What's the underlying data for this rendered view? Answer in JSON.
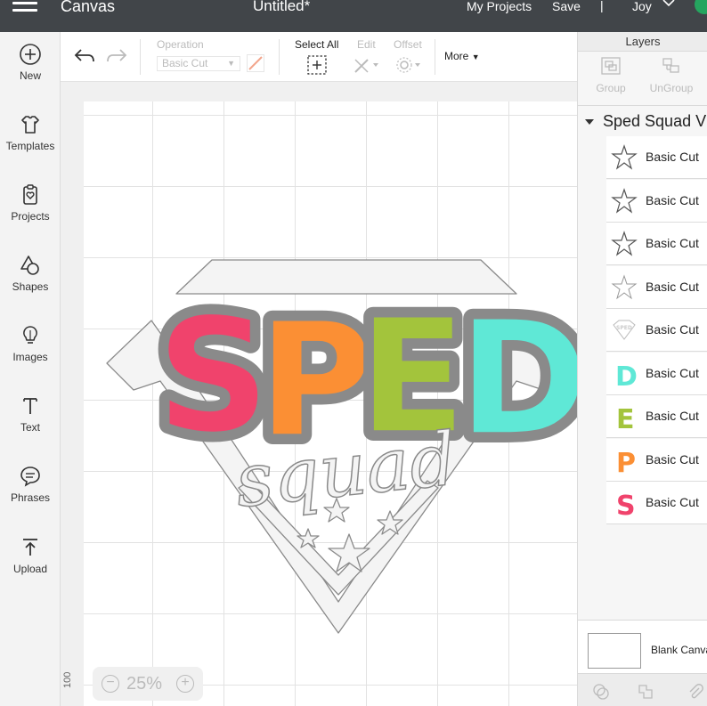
{
  "topbar": {
    "app_title": "Canvas",
    "doc_title": "Untitled*",
    "my_projects": "My Projects",
    "save": "Save",
    "separator": "|",
    "user": "Joy"
  },
  "nav": [
    {
      "label": "New",
      "icon": "plus-circle-icon"
    },
    {
      "label": "Templates",
      "icon": "tshirt-icon"
    },
    {
      "label": "Projects",
      "icon": "clipboard-heart-icon"
    },
    {
      "label": "Shapes",
      "icon": "shapes-icon"
    },
    {
      "label": "Images",
      "icon": "lightbulb-icon"
    },
    {
      "label": "Text",
      "icon": "text-icon"
    },
    {
      "label": "Phrases",
      "icon": "speech-bubble-icon"
    },
    {
      "label": "Upload",
      "icon": "upload-icon"
    }
  ],
  "toolbar": {
    "operation_label": "Operation",
    "operation_value": "Basic Cut",
    "select_all": "Select All",
    "edit": "Edit",
    "offset": "Offset",
    "more": "More"
  },
  "canvas": {
    "ruler_number": "100",
    "zoom": "25%",
    "design_text": {
      "sped": [
        "S",
        "P",
        "E",
        "D"
      ],
      "squad": "squad"
    },
    "colors": {
      "s": "#f0436c",
      "p": "#fb8f34",
      "e": "#a3c43c",
      "d": "#5fe8d6",
      "outline": "#f4f4f4",
      "stroke": "#8a8a8a"
    }
  },
  "layers": {
    "title": "Layers",
    "group_label": "Group",
    "ungroup_label": "UnGroup",
    "group_name": "Sped Squad V",
    "items": [
      {
        "name": "Basic Cut",
        "thumb": "star"
      },
      {
        "name": "Basic Cut",
        "thumb": "star"
      },
      {
        "name": "Basic Cut",
        "thumb": "star"
      },
      {
        "name": "Basic Cut",
        "thumb": "star"
      },
      {
        "name": "Basic Cut",
        "thumb": "diamond"
      },
      {
        "name": "Basic Cut",
        "thumb": "D"
      },
      {
        "name": "Basic Cut",
        "thumb": "E"
      },
      {
        "name": "Basic Cut",
        "thumb": "P"
      },
      {
        "name": "Basic Cut",
        "thumb": "S"
      }
    ],
    "blank_canvas": "Blank Canvas"
  }
}
